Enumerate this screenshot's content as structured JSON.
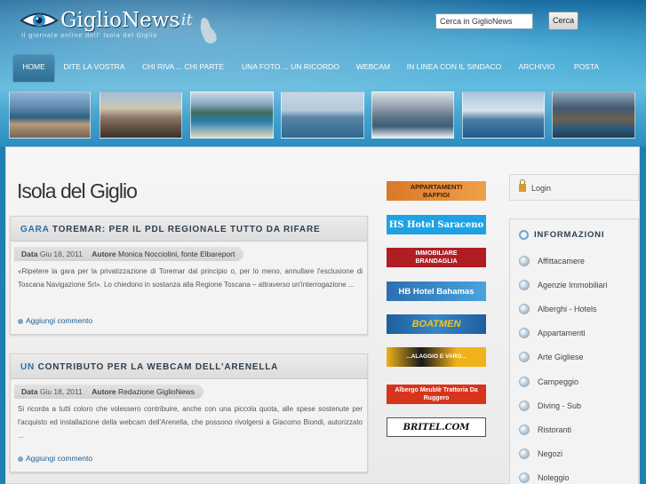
{
  "site": {
    "name": "GiglioNews",
    "tld": ".it",
    "tagline": "Il giornale online dell' isola del Giglio"
  },
  "search": {
    "placeholder": "Cerca in GiglioNews",
    "button": "Cerca"
  },
  "nav": [
    {
      "label": "HOME",
      "active": true
    },
    {
      "label": "DITE LA VOSTRA",
      "active": false
    },
    {
      "label": "CHI RIVA ... CHI PARTE",
      "active": false
    },
    {
      "label": "UNA FOTO ... UN RICORDO",
      "active": false
    },
    {
      "label": "WEBCAM",
      "active": false
    },
    {
      "label": "IN LINEA CON IL SINDACO",
      "active": false
    },
    {
      "label": "ARCHIVIO",
      "active": false
    },
    {
      "label": "POSTA",
      "active": false
    }
  ],
  "page": {
    "title": "Isola del Giglio"
  },
  "articles": [
    {
      "title_first": "GARA",
      "title_rest": "TOREMAR: PER IL PDL REGIONALE TUTTO DA RIFARE",
      "data_label": "Data",
      "date": "Giu 18, 2011",
      "author_label": "Autore",
      "author": "Monica Nocciolini, fonte Elbareport",
      "body": "«Ripetere la gara per la privatizzazione di Toremar dal principio o, per lo meno, annullare l'esclusione di Toscana Navigazione Srl». Lo chiedono in sostanza alla Regione Toscana – attraverso un'interrogazione ...",
      "comment": "Aggiungi commento"
    },
    {
      "title_first": "UN",
      "title_rest": "CONTRIBUTO PER LA WEBCAM DELL'ARENELLA",
      "data_label": "Data",
      "date": "Giu 18, 2011",
      "author_label": "Autore",
      "author": "Redazione GiglioNews",
      "body": "Si ricorda a tutti coloro che volessero contribuire, anche con una piccola quota, alle spese sostenute per l'acquisto ed installazione della webcam dell'Arenella, che possono rivolgersi a Giacomo Biondi, autorizzato ...",
      "comment": "Aggiungi commento"
    }
  ],
  "ads": [
    {
      "text": "APPARTAMENTI BAFFIGI"
    },
    {
      "text": "HS Hotel Saraceno"
    },
    {
      "text": "IMMOBILIARE BRANDAGLIA"
    },
    {
      "text": "HB Hotel Bahamas"
    },
    {
      "text": "BOATMEN"
    },
    {
      "text": "...ALAGGIO E VARO..."
    },
    {
      "text": "Albergo Meublè Trattoria Da Ruggero"
    },
    {
      "text": "BRITEL.COM"
    }
  ],
  "sidebar": {
    "login": "Login",
    "info_title": "INFORMAZIONI",
    "info_items": [
      "Affittacamere",
      "Agenzie Immobiliari",
      "Alberghi - Hotels",
      "Appartamenti",
      "Arte Gigliese",
      "Campeggio",
      "Diving - Sub",
      "Ristoranti",
      "Negozi",
      "Noleggio"
    ]
  },
  "colors": {
    "accent_blue": "#2a6fa8",
    "header_blue": "#1f7fb0"
  }
}
